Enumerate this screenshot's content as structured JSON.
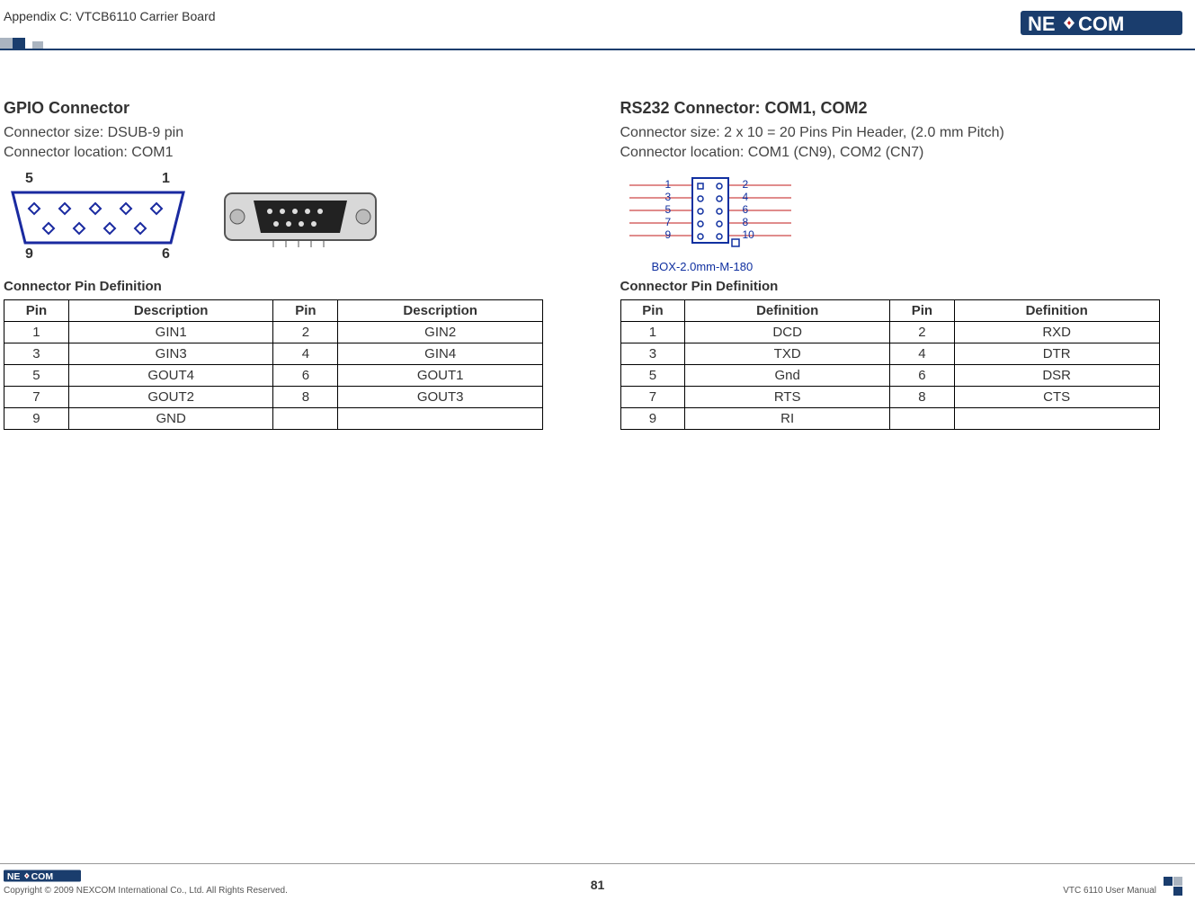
{
  "header": {
    "appendix": "Appendix C: VTCB6110 Carrier Board",
    "brand": "NEXCOM"
  },
  "left": {
    "title": "GPIO Connector",
    "size": "Connector size: DSUB-9 pin",
    "location": "Connector location: COM1",
    "dsub_labels": {
      "tl": "5",
      "tr": "1",
      "bl": "9",
      "br": "6"
    },
    "table_title": "Connector Pin Definition",
    "headers": {
      "pin": "Pin",
      "desc": "Description"
    },
    "rows": [
      {
        "p1": "1",
        "d1": "GIN1",
        "p2": "2",
        "d2": "GIN2"
      },
      {
        "p1": "3",
        "d1": "GIN3",
        "p2": "4",
        "d2": "GIN4"
      },
      {
        "p1": "5",
        "d1": "GOUT4",
        "p2": "6",
        "d2": "GOUT1"
      },
      {
        "p1": "7",
        "d1": "GOUT2",
        "p2": "8",
        "d2": "GOUT3"
      },
      {
        "p1": "9",
        "d1": "GND",
        "p2": "",
        "d2": ""
      }
    ]
  },
  "right": {
    "title": "RS232 Connector: COM1, COM2",
    "size": "Connector size: 2 x 10 = 20 Pins Pin Header, (2.0 mm Pitch)",
    "location": "Connector location: COM1 (CN9), COM2 (CN7)",
    "box_caption": "BOX-2.0mm-M-180",
    "box_labels_left": [
      "1",
      "3",
      "5",
      "7",
      "9"
    ],
    "box_labels_right": [
      "2",
      "4",
      "6",
      "8",
      "10"
    ],
    "table_title": "Connector Pin Definition",
    "headers": {
      "pin": "Pin",
      "def": "Definition"
    },
    "rows": [
      {
        "p1": "1",
        "d1": "DCD",
        "p2": "2",
        "d2": "RXD"
      },
      {
        "p1": "3",
        "d1": "TXD",
        "p2": "4",
        "d2": "DTR"
      },
      {
        "p1": "5",
        "d1": "Gnd",
        "p2": "6",
        "d2": "DSR"
      },
      {
        "p1": "7",
        "d1": "RTS",
        "p2": "8",
        "d2": "CTS"
      },
      {
        "p1": "9",
        "d1": "RI",
        "p2": "",
        "d2": ""
      }
    ]
  },
  "footer": {
    "copyright": "Copyright © 2009 NEXCOM International Co., Ltd. All Rights Reserved.",
    "page": "81",
    "manual": "VTC 6110 User Manual",
    "brand": "NEXCOM"
  }
}
